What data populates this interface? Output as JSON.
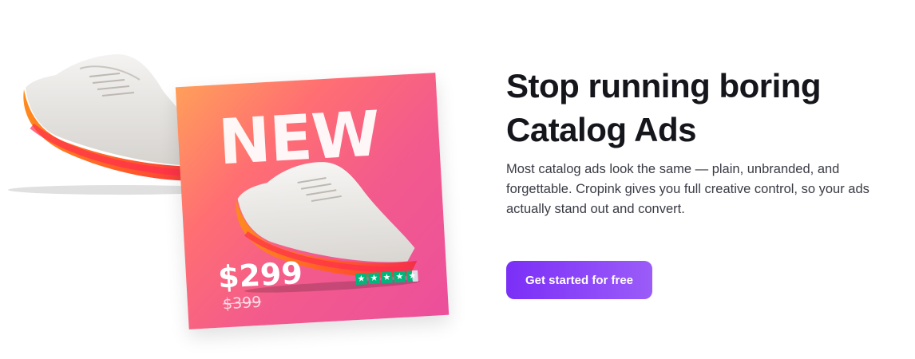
{
  "hero": {
    "title_line1": "Stop running boring",
    "title_line2": "Catalog Ads",
    "description": "Most catalog ads look the same — plain, unbranded, and forgettable. Cropink gives you full creative control, so your ads actually stand out and convert.",
    "cta_label": "Get started for free"
  },
  "ad_card": {
    "badge": "NEW",
    "price": "$299",
    "old_price": "$399",
    "rating": 4.5,
    "star_glyph": "★",
    "rating_icon": "star-icon"
  },
  "colors": {
    "accent": "#7b2ff7",
    "title": "#15151c",
    "rating_green": "#00b67a",
    "card_gradient": [
      "#ff9f5a",
      "#ec4f9b"
    ]
  }
}
